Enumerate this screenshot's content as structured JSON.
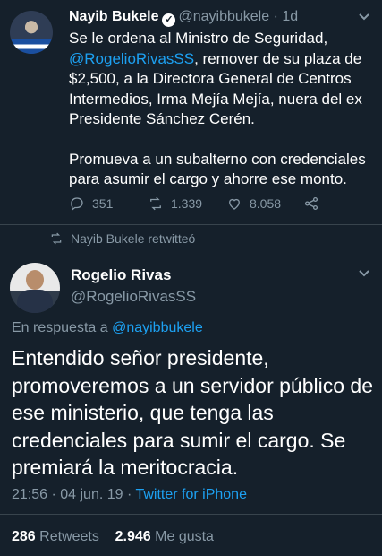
{
  "tweet1": {
    "display_name": "Nayib Bukele",
    "handle": "@nayibbukele",
    "separator": "·",
    "age": "1d",
    "text_line1_a": "Se le ordena al Ministro de Seguridad,",
    "mention": "@RogelioRivasSS",
    "text_line1_b": ", remover de su plaza de $2,500, a la Directora General de Centros Intermedios, Irma Mejía Mejía, nuera del ex Presidente Sánchez Cerén.",
    "text_para2": "Promueva a un subalterno con credenciales para asumir el cargo y ahorre ese monto.",
    "replies": "351",
    "retweets": "1.339",
    "likes": "8.058"
  },
  "retweet_banner": "Nayib Bukele retwitteó",
  "tweet2": {
    "display_name": "Rogelio Rivas",
    "handle": "@RogelioRivasSS",
    "reply_prefix": "En respuesta a",
    "reply_to": "@nayibbukele",
    "text": "Entendido señor presidente, promoveremos a un servidor público de ese ministerio, que tenga las credenciales para sumir el cargo. Se premiará la meritocracia.",
    "time": "21:56 · 04 jun. 19 · ",
    "source": "Twitter for iPhone",
    "retweet_count": "286",
    "retweet_label": "Retweets",
    "like_count": "2.946",
    "like_label": "Me gusta"
  },
  "colors": {
    "background": "#15202b",
    "link": "#1da1f2",
    "muted": "#8899a6",
    "divider": "#38444d"
  },
  "icons": [
    "chevron-down-icon",
    "verified-icon",
    "reply-icon",
    "retweet-icon",
    "like-icon",
    "share-icon"
  ]
}
